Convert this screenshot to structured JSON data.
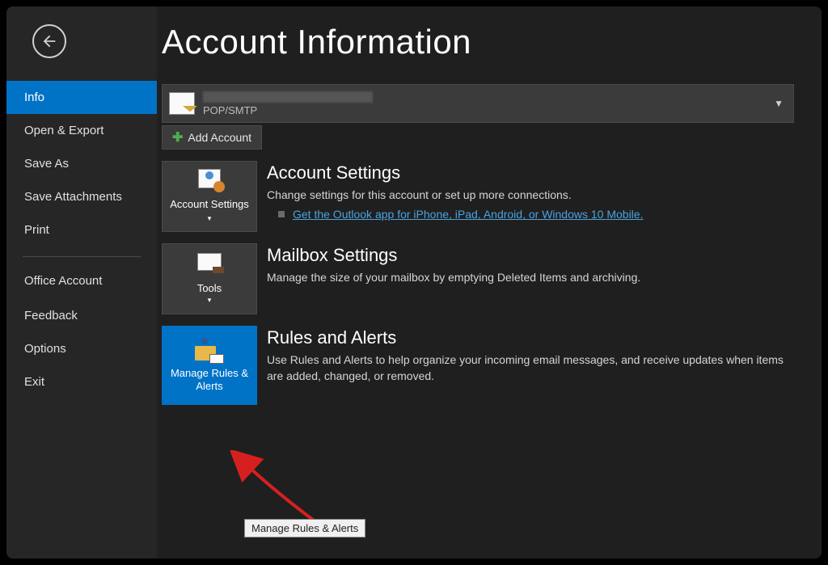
{
  "sidebar": {
    "items": [
      {
        "label": "Info",
        "active": true
      },
      {
        "label": "Open & Export"
      },
      {
        "label": "Save As"
      },
      {
        "label": "Save Attachments"
      },
      {
        "label": "Print"
      },
      {
        "label": "Office Account"
      },
      {
        "label": "Feedback"
      },
      {
        "label": "Options"
      },
      {
        "label": "Exit"
      }
    ]
  },
  "page": {
    "title": "Account Information"
  },
  "account_selector": {
    "type": "POP/SMTP"
  },
  "add_account": {
    "label": "Add Account"
  },
  "sections": {
    "account_settings": {
      "tile_label": "Account Settings",
      "dropdown_caret": "▾",
      "title": "Account Settings",
      "desc": "Change settings for this account or set up more connections.",
      "link": "Get the Outlook app for iPhone, iPad, Android, or Windows 10 Mobile."
    },
    "mailbox_settings": {
      "tile_label": "Tools",
      "dropdown_caret": "▾",
      "title": "Mailbox Settings",
      "desc": "Manage the size of your mailbox by emptying Deleted Items and archiving."
    },
    "rules_alerts": {
      "tile_label": "Manage Rules & Alerts",
      "title": "Rules and Alerts",
      "desc": "Use Rules and Alerts to help organize your incoming email messages, and receive updates when items are added, changed, or removed."
    }
  },
  "tooltip": {
    "text": "Manage Rules & Alerts"
  }
}
